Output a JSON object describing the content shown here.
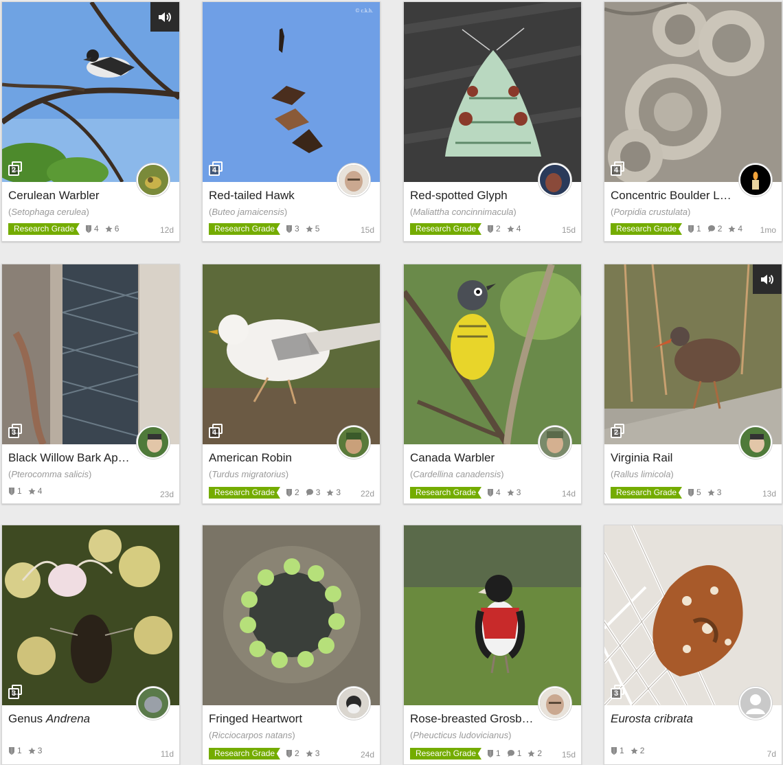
{
  "quality_label": "Research Grade",
  "colors": {
    "research_grade": "#74ac00",
    "background": "#ebebeb"
  },
  "cards": [
    {
      "id": "c1",
      "common": "Cerulean Warbler",
      "sci": "Setophaga cerulea",
      "photos": "2",
      "ids": "4",
      "comments": "",
      "faves": "6",
      "age": "12d",
      "research": true,
      "sound": true
    },
    {
      "id": "c2",
      "common": "Red-tailed Hawk",
      "sci": "Buteo jamaicensis",
      "photos": "4",
      "ids": "3",
      "comments": "",
      "faves": "5",
      "age": "15d",
      "research": true,
      "sound": false,
      "watermark": "© c.k.h."
    },
    {
      "id": "c3",
      "common": "Red-spotted Glyph",
      "sci": "Maliattha concinnimacula",
      "photos": "",
      "ids": "2",
      "comments": "",
      "faves": "4",
      "age": "15d",
      "research": true,
      "sound": false
    },
    {
      "id": "c4",
      "common": "Concentric Boulder Lic...",
      "sci": "Porpidia crustulata",
      "photos": "4",
      "ids": "1",
      "comments": "2",
      "faves": "4",
      "age": "1mo",
      "research": true,
      "sound": false
    },
    {
      "id": "c5",
      "common": "Black Willow Bark Aphid",
      "sci": "Pterocomma salicis",
      "photos": "3",
      "ids": "1",
      "comments": "",
      "faves": "4",
      "age": "23d",
      "research": false,
      "sound": false
    },
    {
      "id": "c6",
      "common": "American Robin",
      "sci": "Turdus migratorius",
      "photos": "4",
      "ids": "2",
      "comments": "3",
      "faves": "3",
      "age": "22d",
      "research": true,
      "sound": false
    },
    {
      "id": "c7",
      "common": "Canada Warbler",
      "sci": "Cardellina canadensis",
      "photos": "",
      "ids": "4",
      "comments": "",
      "faves": "3",
      "age": "14d",
      "research": true,
      "sound": false
    },
    {
      "id": "c8",
      "common": "Virginia Rail",
      "sci": "Rallus limicola",
      "photos": "2",
      "ids": "5",
      "comments": "",
      "faves": "3",
      "age": "13d",
      "research": true,
      "sound": true
    },
    {
      "id": "c9",
      "common_prefix": "Genus",
      "common_italic": "Andrena",
      "sci": "",
      "photos": "3",
      "ids": "1",
      "comments": "",
      "faves": "3",
      "age": "11d",
      "research": false,
      "sound": false
    },
    {
      "id": "c10",
      "common": "Fringed Heartwort",
      "sci": "Ricciocarpos natans",
      "photos": "",
      "ids": "2",
      "comments": "",
      "faves": "3",
      "age": "24d",
      "research": true,
      "sound": false
    },
    {
      "id": "c11",
      "common": "Rose-breasted Grosbeak",
      "sci": "Pheucticus ludovicianus",
      "photos": "",
      "ids": "1",
      "comments": "1",
      "faves": "2",
      "age": "15d",
      "research": true,
      "sound": false
    },
    {
      "id": "c12",
      "common_prefix": "",
      "common_italic": "Eurosta cribrata",
      "sci": "",
      "photos": "3",
      "ids": "1",
      "comments": "",
      "faves": "2",
      "age": "7d",
      "research": false,
      "sound": false
    }
  ],
  "icons": {
    "sound": "speaker-icon",
    "ids": "id-shield-icon",
    "comments": "comment-bubble-icon",
    "faves": "star-icon",
    "photos": "photo-stack-icon"
  }
}
